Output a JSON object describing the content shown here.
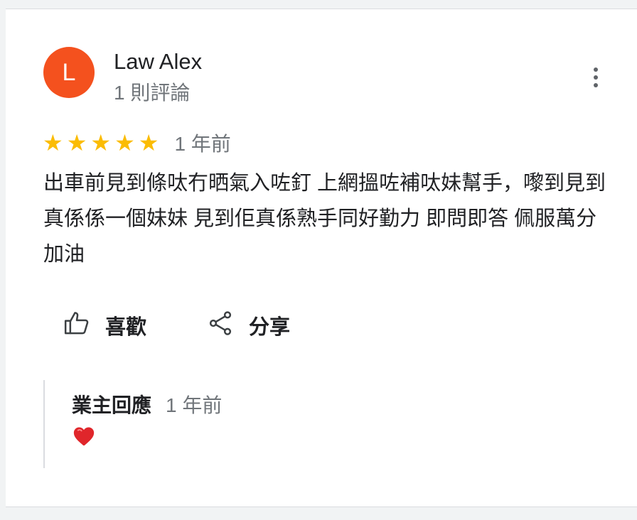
{
  "review": {
    "avatar_letter": "L",
    "avatar_color": "#f4511e",
    "reviewer_name": "Law Alex",
    "review_count": "1 則評論",
    "rating": 5,
    "max_rating": 5,
    "star_color": "#fbbc04",
    "time": "1 年前",
    "text": "出車前見到條呔冇晒氣入咗釘 上網搵咗補呔妹幫手，嚟到見到真係係一個妹妹 見到佢真係熟手同好勤力 即問即答 佩服萬分 加油",
    "more_icon": "more-vert-icon"
  },
  "actions": {
    "like_label": "喜歡",
    "like_icon": "thumb-up-icon",
    "share_label": "分享",
    "share_icon": "share-icon"
  },
  "owner_reply": {
    "author": "業主回應",
    "time": "1 年前",
    "body_icon": "red-heart-emoji"
  }
}
